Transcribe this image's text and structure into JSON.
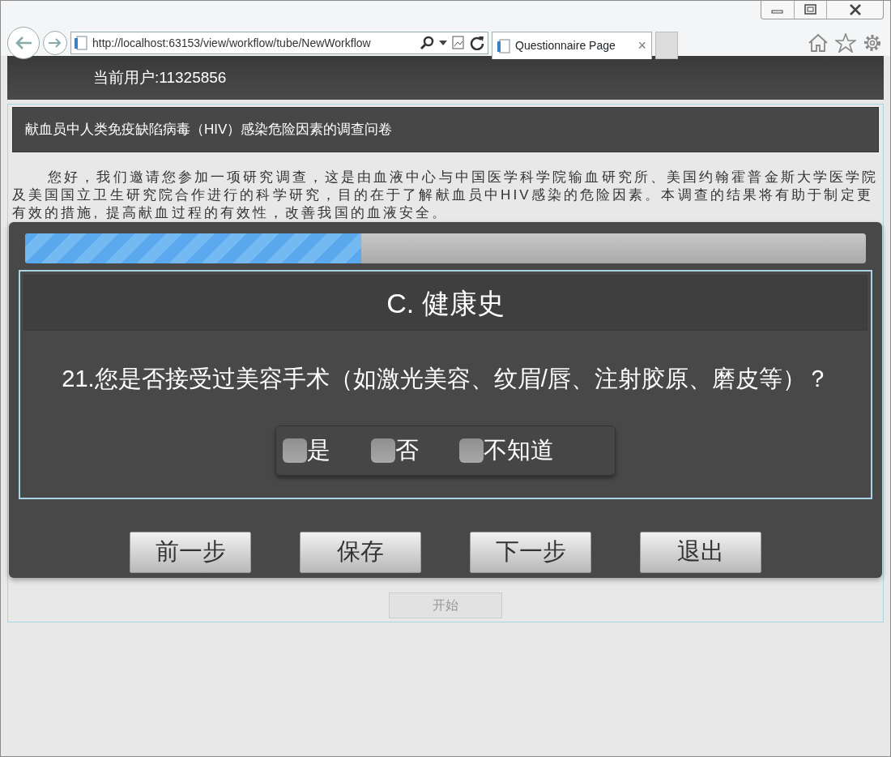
{
  "browser": {
    "url": "http://localhost:63153/view/workflow/tube/NewWorkflow",
    "tabs": [
      {
        "title": "Questionnaire Page",
        "close": "×",
        "selected": true
      }
    ]
  },
  "header": {
    "user_label": "当前用户:11325856"
  },
  "survey": {
    "title": "献血员中人类免疫缺陷病毒（HIV）感染危险因素的调查问卷",
    "intro": "您好，我们邀请您参加一项研究调查，这是由血液中心与中国医学科学院输血研究所、美国约翰霍普金斯大学医学院及美国国立卫生研究院合作进行的科学研究，目的在于了解献血员中HIV感染的危险因素。本调查的结果将有助于制定更有效的措施, 提高献血过程的有效性，改善我国的血液安全。",
    "progress": {
      "level": 0.4
    },
    "section": "C. 健康史",
    "question": "21.您是否接受过美容手术（如激光美容、纹眉/唇、注射胶原、磨皮等）？",
    "options": [
      {
        "label": "是",
        "checked": false
      },
      {
        "label": "否",
        "checked": false
      },
      {
        "label": "不知道",
        "checked": false
      }
    ],
    "buttons": [
      "前一步",
      "保存",
      "下一步",
      "退出"
    ],
    "start_button": {
      "label": "开始",
      "disabled": true
    }
  }
}
